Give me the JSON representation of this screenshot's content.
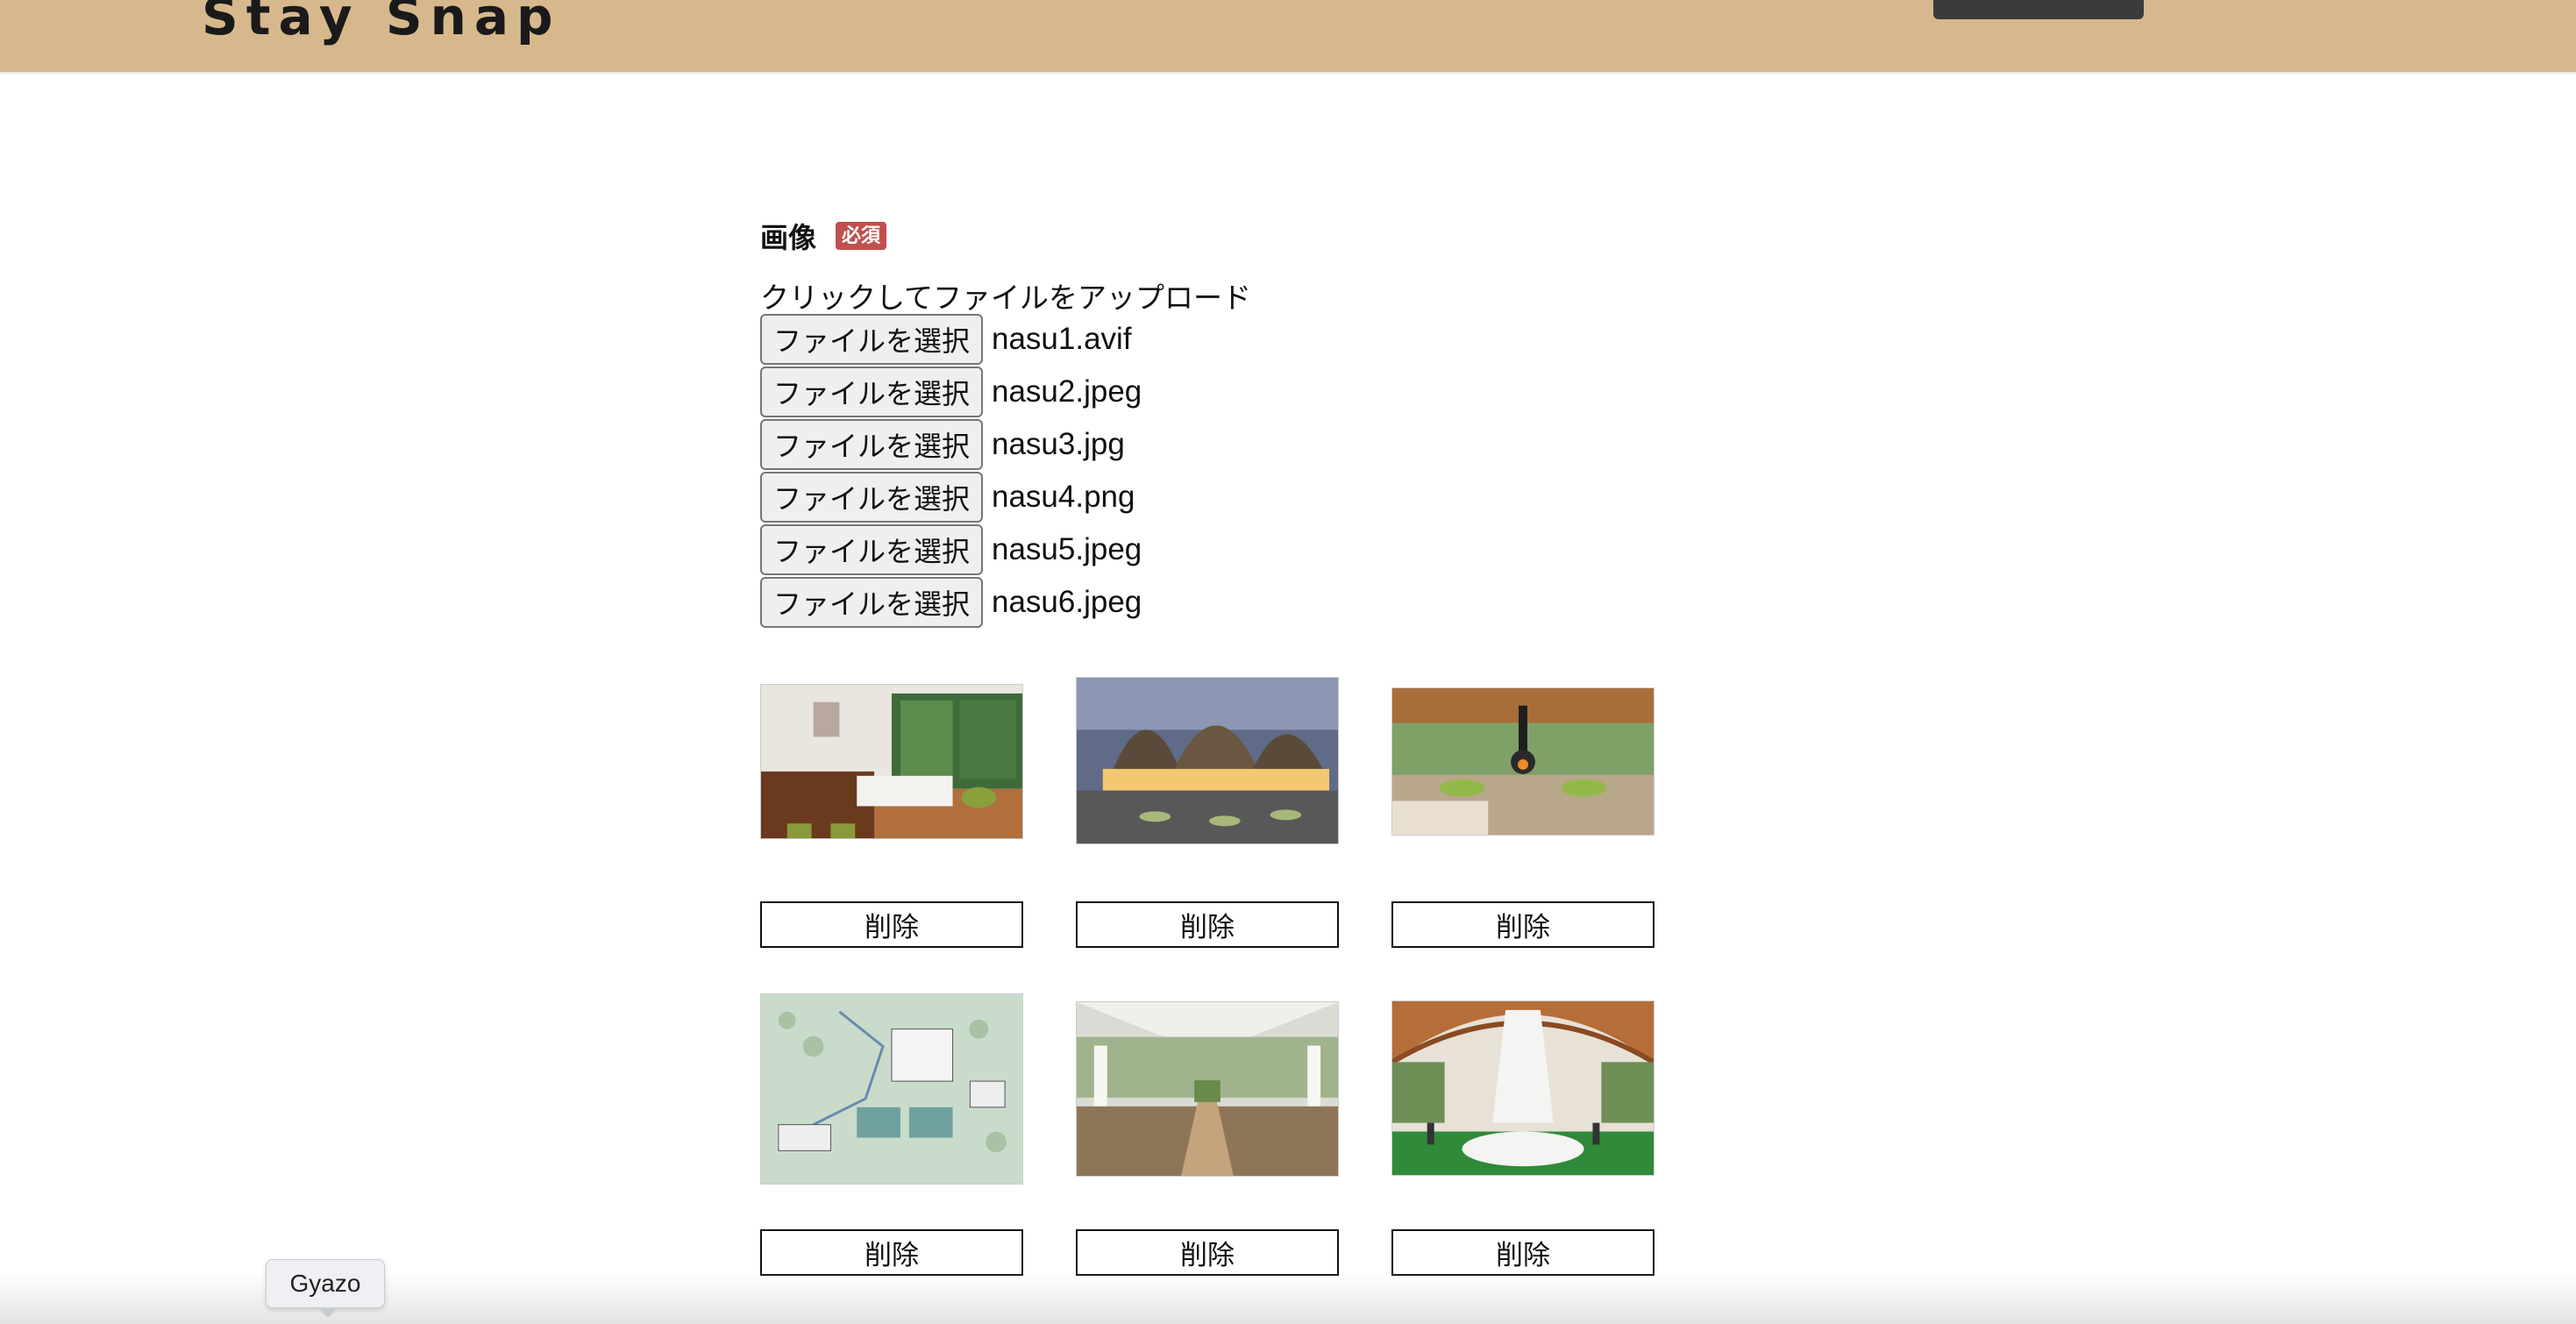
{
  "header": {
    "logo": "Stay Snap"
  },
  "form": {
    "image_label": "画像",
    "required_badge": "必須",
    "upload_hint": "クリックしてファイルをアップロード",
    "file_inputs": [
      {
        "button": "ファイルを選択",
        "filename": "nasu1.avif"
      },
      {
        "button": "ファイルを選択",
        "filename": "nasu2.jpeg"
      },
      {
        "button": "ファイルを選択",
        "filename": "nasu3.jpg"
      },
      {
        "button": "ファイルを選択",
        "filename": "nasu4.png"
      },
      {
        "button": "ファイルを選択",
        "filename": "nasu5.jpeg"
      },
      {
        "button": "ファイルを選択",
        "filename": "nasu6.jpeg"
      }
    ]
  },
  "previews": [
    {
      "delete_label": "削除"
    },
    {
      "delete_label": "削除"
    },
    {
      "delete_label": "削除"
    },
    {
      "delete_label": "削除"
    },
    {
      "delete_label": "削除"
    },
    {
      "delete_label": "削除"
    }
  ],
  "tooltip": {
    "text": "Gyazo"
  },
  "colors": {
    "header_bg": "#d6b88c",
    "required_badge": "#c0504d"
  }
}
